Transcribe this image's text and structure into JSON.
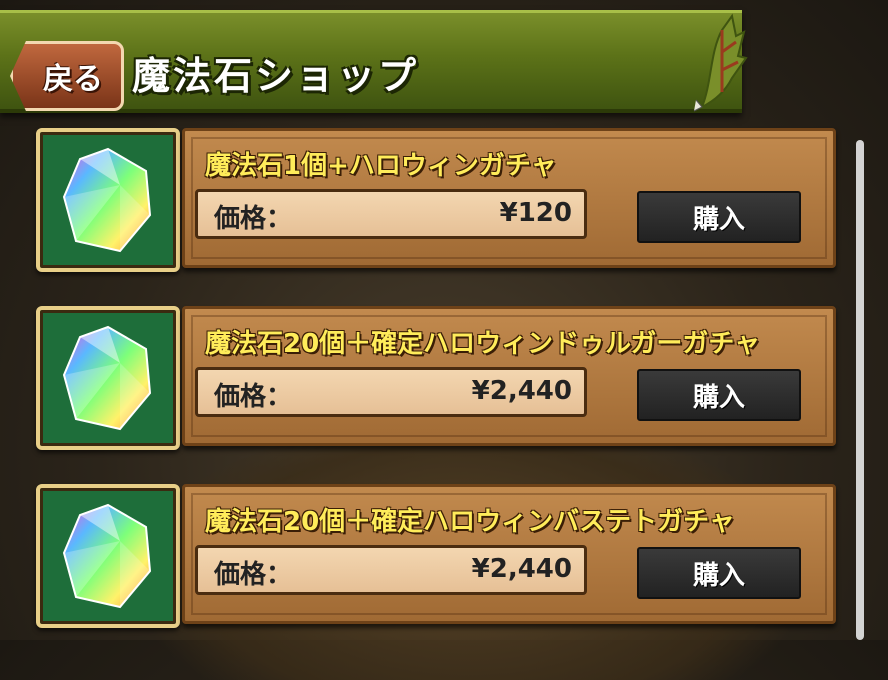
{
  "header": {
    "back_label": "戻る",
    "title": "魔法石ショップ"
  },
  "items": [
    {
      "name": "魔法石1個+ハロウィンガチャ",
      "price_label": "価格：",
      "price": "¥120",
      "buy_label": "購入"
    },
    {
      "name": "魔法石20個＋確定ハロウィンドゥルガーガチャ",
      "price_label": "価格：",
      "price": "¥2,440",
      "buy_label": "購入"
    },
    {
      "name": "魔法石20個＋確定ハロウィンバステトガチャ",
      "price_label": "価格：",
      "price": "¥2,440",
      "buy_label": "購入"
    }
  ],
  "icons": {
    "gem": "magic-stone-icon",
    "decoration": "dragon-wing-icon"
  },
  "colors": {
    "header_green": "#5c7218",
    "title_yellow": "#ffec5a",
    "gem_frame_green": "#1e6e3a",
    "panel_brown": "#b07a40"
  }
}
